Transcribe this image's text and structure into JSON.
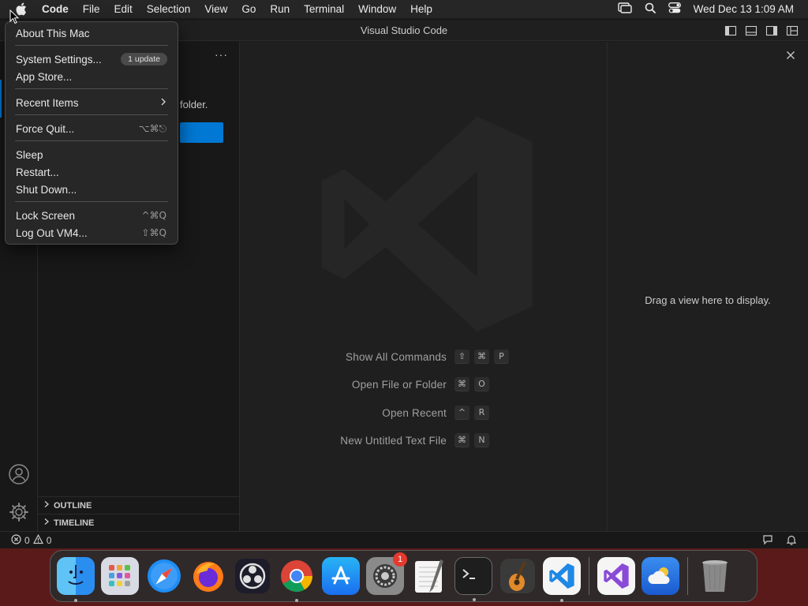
{
  "menubar": {
    "app_name": "Code",
    "items": [
      "File",
      "Edit",
      "Selection",
      "View",
      "Go",
      "Run",
      "Terminal",
      "Window",
      "Help"
    ],
    "clock": "Wed Dec 13  1:09 AM"
  },
  "apple_menu": {
    "about": "About This Mac",
    "system_settings": "System Settings...",
    "update_badge": "1 update",
    "app_store": "App Store...",
    "recent_items": "Recent Items",
    "force_quit": "Force Quit...",
    "force_quit_shortcut": "⌥⌘⎋",
    "sleep": "Sleep",
    "restart": "Restart...",
    "shut_down": "Shut Down...",
    "lock_screen": "Lock Screen",
    "lock_screen_shortcut": "^⌘Q",
    "log_out": "Log Out VM4...",
    "log_out_shortcut": "⇧⌘Q"
  },
  "window": {
    "title": "Visual Studio Code"
  },
  "sidebar": {
    "more": "···",
    "message_fragment": "folder.",
    "sections": [
      "OUTLINE",
      "TIMELINE"
    ]
  },
  "editor": {
    "shortcuts": [
      {
        "label": "Show All Commands",
        "keys": [
          "⇧",
          "⌘",
          "P"
        ]
      },
      {
        "label": "Open File or Folder",
        "keys": [
          "⌘",
          "O"
        ]
      },
      {
        "label": "Open Recent",
        "keys": [
          "^",
          "R"
        ]
      },
      {
        "label": "New Untitled Text File",
        "keys": [
          "⌘",
          "N"
        ]
      }
    ]
  },
  "right_panel": {
    "message": "Drag a view here to display."
  },
  "statusbar": {
    "errors": "0",
    "warnings": "0"
  },
  "dock": {
    "apps": [
      "Finder",
      "Launchpad",
      "Safari",
      "Firefox",
      "OBS",
      "Chrome",
      "App Store",
      "System Settings",
      "TextEdit",
      "Terminal",
      "GarageBand",
      "Visual Studio Code",
      "Visual Studio",
      "Weather",
      "Trash"
    ],
    "system_settings_badge": "1"
  },
  "colors": {
    "accent": "#0078d4",
    "menubar_bg": "#262626",
    "editor_bg": "#1f1f1f",
    "badge_red": "#e5392e"
  }
}
